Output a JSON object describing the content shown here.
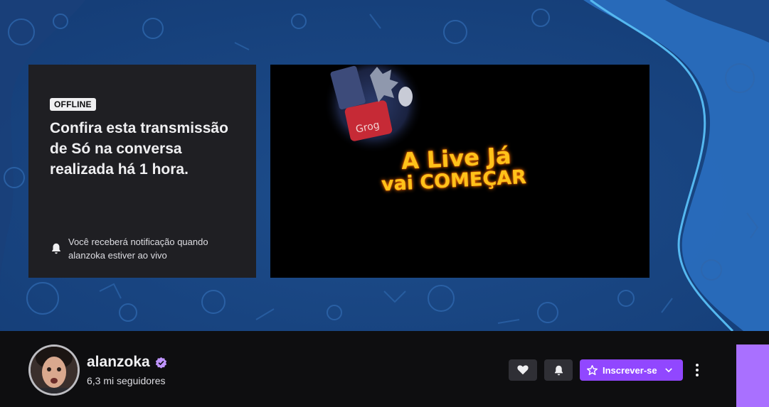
{
  "offline_card": {
    "badge": "OFFLINE",
    "title": "Confira esta transmissão de Só na conversa realizada há 1 hora.",
    "notification_text": "Você receberá notificação quando alanzoka estiver ao vivo"
  },
  "video": {
    "line1": "A Live Já",
    "line2": "vai COMEÇAR"
  },
  "channel": {
    "name": "alanzoka",
    "followers": "6,3 mi seguidores",
    "subscribe_label": "Inscrever-se"
  },
  "colors": {
    "banner_blue": "#1f4f8f",
    "card_bg": "#1f1f23",
    "accent_purple": "#9147ff",
    "strip_purple": "#a970ff",
    "page_bg": "#0e0e10"
  },
  "icons": {
    "notify": "bell-icon",
    "verified": "verified-badge-icon",
    "follow": "heart-icon",
    "notifications": "bell-icon",
    "subscribe": "star-icon",
    "dropdown": "chevron-down-icon",
    "more": "more-vertical-icon"
  }
}
